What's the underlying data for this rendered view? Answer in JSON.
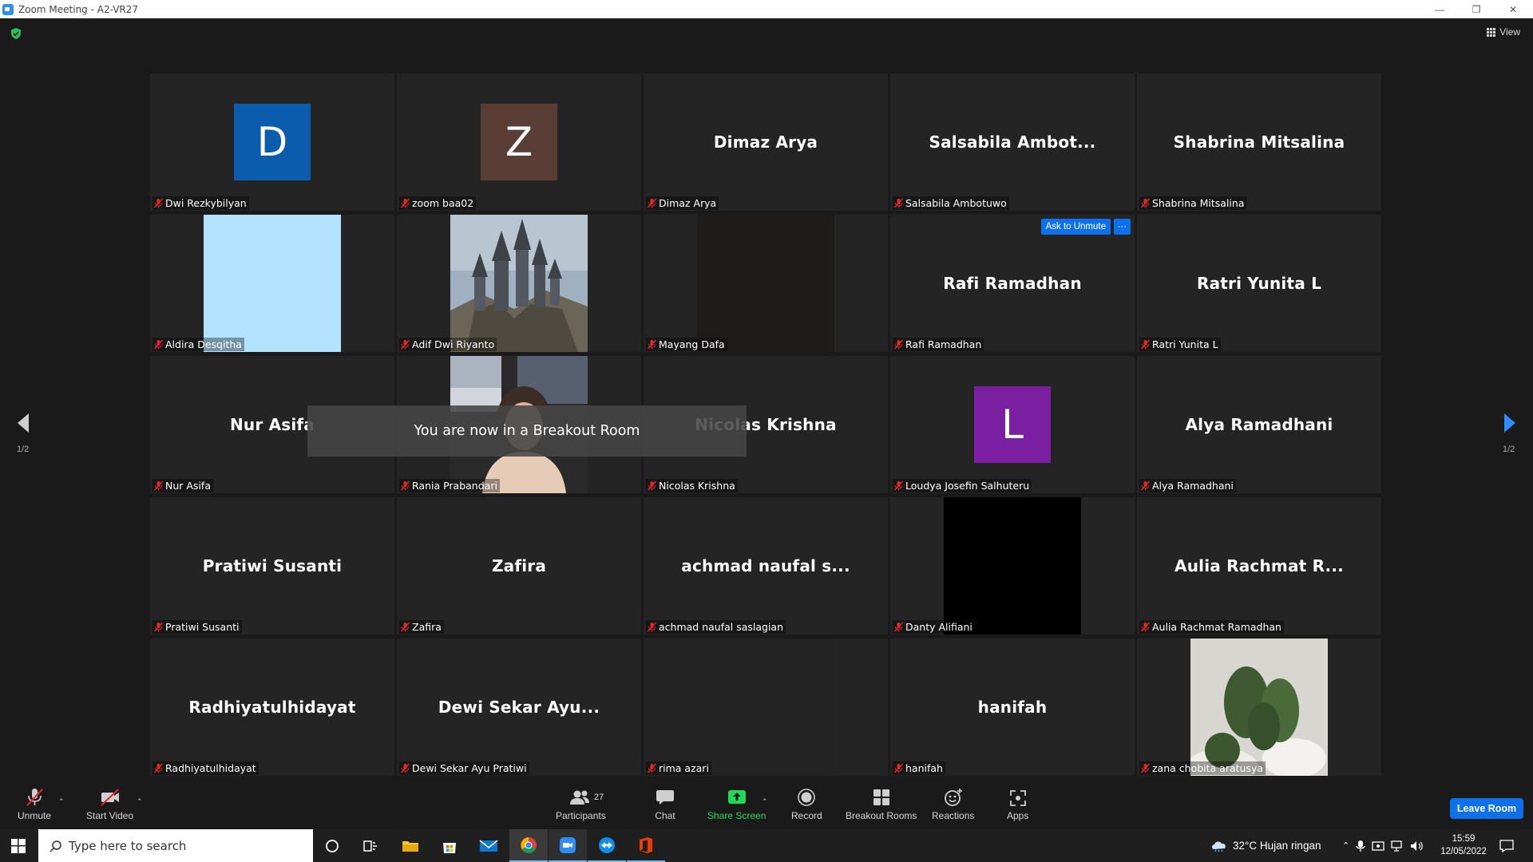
{
  "window": {
    "title": "Zoom Meeting - A2-VR27",
    "minimize": "—",
    "restore": "❐",
    "close": "✕"
  },
  "header": {
    "view_label": "View",
    "page_left": "1/2",
    "page_right": "1/2"
  },
  "tiles": [
    {
      "display": "avatar",
      "initial": "D",
      "color": "#0b5cad",
      "name": "Dwi Rezkybilyan"
    },
    {
      "display": "avatar",
      "initial": "Z",
      "color": "#5a3e36",
      "name": "zoom baa02"
    },
    {
      "display": "name",
      "big": "Dimaz Arya",
      "name": "Dimaz Arya"
    },
    {
      "display": "name",
      "big": "Salsabila  Ambot...",
      "name": "Salsabila Ambotuwo"
    },
    {
      "display": "name",
      "big": "Shabrina Mitsalina",
      "name": "Shabrina Mitsalina"
    },
    {
      "display": "video",
      "color": "#b3e2ff",
      "name": "Aldira Desqitha"
    },
    {
      "display": "video",
      "image": "castle",
      "name": "Adif Dwi Riyanto"
    },
    {
      "display": "video",
      "color": "#1f1c1c",
      "name": "Mayang Dafa"
    },
    {
      "display": "name",
      "big": "Rafi Ramadhan",
      "name": "Rafi Ramadhan",
      "ask_unmute": "Ask to Unmute",
      "more": "···"
    },
    {
      "display": "name",
      "big": "Ratri Yunita L",
      "name": "Ratri Yunita L"
    },
    {
      "display": "name",
      "big": "Nur Asifa",
      "name": "Nur Asifa"
    },
    {
      "display": "video",
      "image": "portrait",
      "name": "Rania Prabandari"
    },
    {
      "display": "name",
      "big": "Nicolas Krishna",
      "name": "Nicolas Krishna"
    },
    {
      "display": "avatar",
      "initial": "L",
      "color": "#7b1fa2",
      "name": "Loudya Josefin Salhuteru"
    },
    {
      "display": "name",
      "big": "Alya Ramadhani",
      "name": "Alya Ramadhani"
    },
    {
      "display": "name",
      "big": "Pratiwi Susanti",
      "name": "Pratiwi Susanti"
    },
    {
      "display": "name",
      "big": "Zafira",
      "name": "Zafira"
    },
    {
      "display": "name",
      "big": "achmad  naufal  s...",
      "name": "achmad naufal saslagian"
    },
    {
      "display": "video",
      "color": "#000000",
      "name": "Danty Alifiani"
    },
    {
      "display": "name",
      "big": "Aulia Rachmat  R...",
      "name": "Aulia Rachmat Ramadhan"
    },
    {
      "display": "name",
      "big": "Radhiyatulhidayat",
      "name": "Radhiyatulhidayat"
    },
    {
      "display": "name",
      "big": "Dewi Sekar Ayu...",
      "name": "Dewi Sekar Ayu Pratiwi"
    },
    {
      "display": "video",
      "color": "#232323",
      "name": "rima azari"
    },
    {
      "display": "name",
      "big": "hanifah",
      "name": "hanifah"
    },
    {
      "display": "video",
      "image": "cactus",
      "name": "zana chobita aratusya"
    }
  ],
  "toast": "You are now in a Breakout Room",
  "toolbar": {
    "unmute": "Unmute",
    "start_video": "Start Video",
    "participants": "Participants",
    "participants_count": "27",
    "chat": "Chat",
    "share_screen": "Share Screen",
    "record": "Record",
    "breakout_rooms": "Breakout Rooms",
    "reactions": "Reactions",
    "apps": "Apps",
    "leave_room": "Leave Room"
  },
  "colors": {
    "accent_blue": "#0e71eb",
    "share_green": "#23d959",
    "mute_red": "#e02828"
  },
  "taskbar": {
    "search_placeholder": "Type here to search",
    "weather": "32°C  Hujan ringan",
    "time": "15:59",
    "date": "12/05/2022"
  }
}
